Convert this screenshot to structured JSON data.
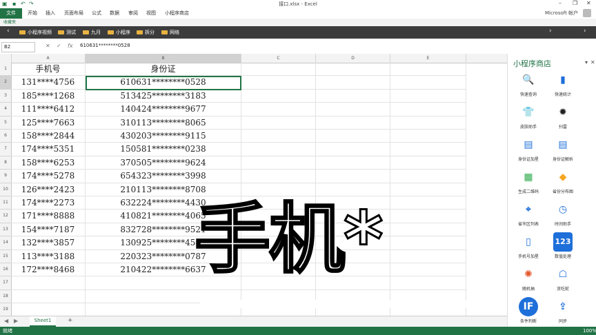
{
  "window": {
    "title": "接口.xlsx - Excel"
  },
  "ribbon": {
    "file": "文件",
    "tabs": [
      "开始",
      "插入",
      "页面布局",
      "公式",
      "数据",
      "审阅",
      "视图",
      "小程序商店"
    ],
    "account": "Microsoft 帐户"
  },
  "favorites": {
    "label": "收藏夹",
    "items": [
      "小程序视频",
      "测试",
      "九月",
      "小程序",
      "拆分",
      "网络"
    ]
  },
  "formula_bar": {
    "name_box": "B2",
    "fx": "fx",
    "value": "610631********0528"
  },
  "grid": {
    "columns": [
      "A",
      "B",
      "C",
      "D",
      "E"
    ],
    "headers": [
      "手机号",
      "身份证"
    ],
    "rows": [
      [
        "131****4756",
        "610631********0528"
      ],
      [
        "185****1268",
        "513425********3183"
      ],
      [
        "111****6412",
        "140424********9677"
      ],
      [
        "125****7663",
        "310113********8065"
      ],
      [
        "158****2844",
        "430203********9115"
      ],
      [
        "174****5351",
        "150581********0238"
      ],
      [
        "158****6253",
        "370505********9624"
      ],
      [
        "174****5278",
        "654323********3998"
      ],
      [
        "126****2423",
        "210113********8708"
      ],
      [
        "174****2273",
        "632224********4430"
      ],
      [
        "171****8888",
        "410821********4065"
      ],
      [
        "154****7187",
        "832728********9521"
      ],
      [
        "132****3857",
        "130925********4583"
      ],
      [
        "113****3188",
        "220323********0787"
      ],
      [
        "172****8468",
        "210422********6637"
      ]
    ],
    "row_numbers": [
      "1",
      "2",
      "3",
      "4",
      "5",
      "6",
      "7",
      "8",
      "9",
      "10",
      "11",
      "12",
      "13",
      "14",
      "15",
      "16",
      "17",
      "18",
      "19"
    ]
  },
  "sheet_tabs": {
    "active": "Sheet1",
    "add": "+"
  },
  "status": {
    "mode": "就绪",
    "zoom": "100%"
  },
  "panel": {
    "title": "小程序商店",
    "tools": [
      {
        "label": "快速查询",
        "icon": "search-icon",
        "color": "#2aa84a",
        "glyph": "🔍"
      },
      {
        "label": "快速统计",
        "icon": "bar-chart-icon",
        "color": "#1e6fd9",
        "glyph": "▮"
      },
      {
        "label": "皮肤助手",
        "icon": "tshirt-icon",
        "color": "#e2552b",
        "glyph": "👕"
      },
      {
        "label": "扫雷",
        "icon": "bomb-icon",
        "color": "#222222",
        "glyph": "✹"
      },
      {
        "label": "身份证加星",
        "icon": "id-card-icon",
        "color": "#1e6fd9",
        "glyph": "▤"
      },
      {
        "label": "身份证解析",
        "icon": "id-card-scan-icon",
        "color": "#1e6fd9",
        "glyph": "▤"
      },
      {
        "label": "生成二维码",
        "icon": "qr-code-icon",
        "color": "#2aa84a",
        "glyph": "▦"
      },
      {
        "label": "省份分布图",
        "icon": "map-icon",
        "color": "#f5a623",
        "glyph": "◆"
      },
      {
        "label": "省市区列表",
        "icon": "location-pin-icon",
        "color": "#1e6fd9",
        "glyph": "⌖"
      },
      {
        "label": "时间助手",
        "icon": "clock-icon",
        "color": "#1e6fd9",
        "glyph": "◷"
      },
      {
        "label": "手机号加星",
        "icon": "phone-icon",
        "color": "#1e6fd9",
        "glyph": "▯"
      },
      {
        "label": "数值处理",
        "icon": "number-icon",
        "color": "#1e6fd9",
        "glyph": "123"
      },
      {
        "label": "随机抽",
        "icon": "wheel-icon",
        "color": "#e2552b",
        "glyph": "✺"
      },
      {
        "label": "贪吃蛇",
        "icon": "ghost-icon",
        "color": "#1e6fd9",
        "glyph": "☖"
      },
      {
        "label": "条件判断",
        "icon": "if-icon",
        "color": "#1e6fd9",
        "glyph": "IF"
      },
      {
        "label": "同步",
        "icon": "upload-icon",
        "color": "#1e6fd9",
        "glyph": "⇪"
      }
    ]
  },
  "overlay": {
    "text": "手机*"
  }
}
